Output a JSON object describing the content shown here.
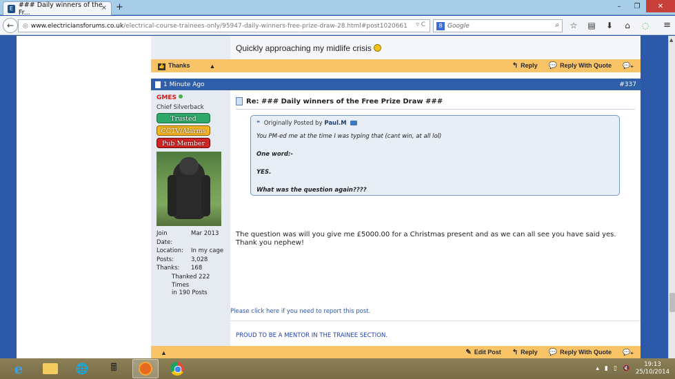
{
  "browser": {
    "tab_title": "### Daily winners of the Fr...",
    "tab_close": "×",
    "new_tab": "+",
    "url_domain": "www.electriciansforums.co.uk",
    "url_path": "/electrical-course-trainees-only/95947-daily-winners-free-prize-draw-28.html#post1020661",
    "search_engine_label": "8",
    "search_placeholder": "Google"
  },
  "prev_post": {
    "message": "Quickly approaching my midlife crisis",
    "thanks_label": "Thanks",
    "reply_label": "Reply",
    "reply_quote_label": "Reply With Quote"
  },
  "post": {
    "time": "1 Minute Ago",
    "number": "#337",
    "user": {
      "name": "GMES",
      "title": "Chief Silverback",
      "badges": [
        "Trusted",
        "CCTV/Alarms",
        "Pub Member"
      ],
      "join_date_label": "Join Date:",
      "join_date": "Mar 2013",
      "location_label": "Location:",
      "location": "In my cage",
      "posts_label": "Posts:",
      "posts": "3,028",
      "thanks_label": "Thanks:",
      "thanks": "168",
      "thanked_line1": "Thanked 222 Times",
      "thanked_line2": "in 190 Posts"
    },
    "title": "Re: ### Daily winners of the Free Prize Draw ###",
    "quote": {
      "by_prefix": "Originally Posted by",
      "by_name": "Paul.M",
      "line1": "You PM-ed me at the time I was typing that (cant win, at all lol)",
      "line2": "One word:-",
      "line3": "YES.",
      "line4": "What was the question again????"
    },
    "reply_line1": "The question was will you give me £5000.00 for a Christmas present and as we can all see you have said yes.",
    "reply_line2": "Thank you nephew!",
    "report_link": "Please click here if you need to report this post.",
    "signature": "PROUD TO BE A MENTOR IN THE TRAINEE SECTION.",
    "edit_label": "Edit Post",
    "reply_label": "Reply",
    "reply_quote_label": "Reply With Quote"
  },
  "taskbar": {
    "time": "19:13",
    "date": "25/10/2014"
  }
}
